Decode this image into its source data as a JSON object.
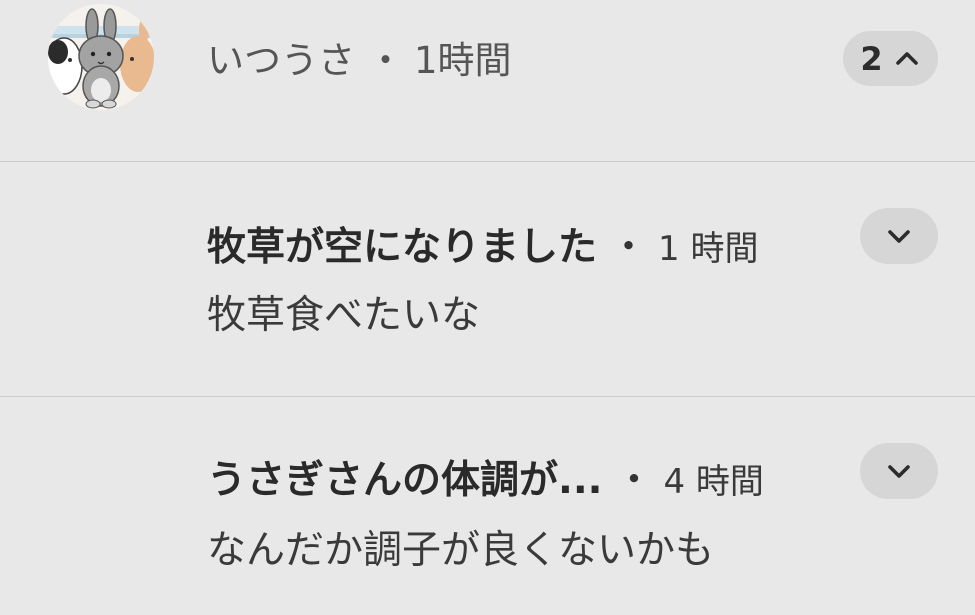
{
  "group": {
    "app_name": "いつうさ",
    "separator": "・",
    "time": "1時間",
    "count": "2",
    "avatar_icon": "rabbit-avatar-icon",
    "collapse_icon": "chevron-up-icon"
  },
  "notifications": [
    {
      "title": "牧草が空になりました",
      "separator": "・",
      "time": "1 時間",
      "body": "牧草食べたいな",
      "expand_icon": "chevron-down-icon"
    },
    {
      "title": "うさぎさんの体調が...",
      "separator": "・",
      "time": "4 時間",
      "body": "なんだか調子が良くないかも",
      "expand_icon": "chevron-down-icon"
    }
  ],
  "colors": {
    "background": "#e8e8e8",
    "pill": "#d6d6d6",
    "divider": "#cbcbcb"
  }
}
